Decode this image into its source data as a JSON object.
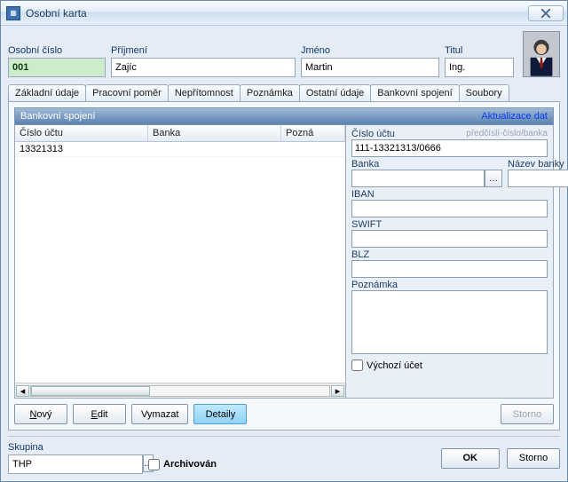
{
  "window": {
    "title": "Osobní karta"
  },
  "header": {
    "id_label": "Osobní číslo",
    "id_value": "001",
    "surname_label": "Příjmení",
    "surname_value": "Zajíc",
    "name_label": "Jméno",
    "name_value": "Martin",
    "title_label": "Titul",
    "title_value": "Ing."
  },
  "tabs": {
    "basic": "Základní údaje",
    "employment": "Pracovní poměr",
    "absence": "Nepřítomnost",
    "note": "Poznámka",
    "other": "Ostatní údaje",
    "banking": "Bankovní spojení",
    "files": "Soubory"
  },
  "panel": {
    "title": "Bankovní spojení",
    "refresh": "Aktualizace dat"
  },
  "grid": {
    "col_account": "Číslo účtu",
    "col_bank": "Banka",
    "col_note": "Pozná",
    "rows": [
      {
        "account": "13321313",
        "bank": "",
        "note": ""
      }
    ]
  },
  "detail": {
    "account_label": "Číslo účtu",
    "account_hint": "předčíslí-číslo/banka",
    "account_value": "111-13321313/0666",
    "bank_label": "Banka",
    "bank_value": "",
    "bank_name_label": "Název banky",
    "bank_name_value": "",
    "iban_label": "IBAN",
    "iban_value": "",
    "swift_label": "SWIFT",
    "swift_value": "",
    "blz_label": "BLZ",
    "blz_value": "",
    "note_label": "Poznámka",
    "note_value": "",
    "default_label": "Výchozí účet"
  },
  "buttons": {
    "new": "Nový",
    "edit": "Edit",
    "delete": "Vymazat",
    "details": "Detaily",
    "storno": "Storno",
    "ok": "OK"
  },
  "footer": {
    "group_label": "Skupina",
    "group_value": "THP",
    "archived_label": "Archivován"
  }
}
